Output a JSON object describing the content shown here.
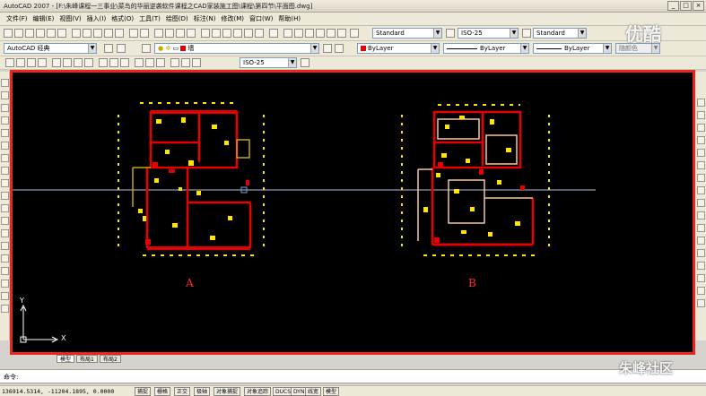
{
  "window": {
    "title": "AutoCAD 2007 - [F:\\朱峰课程一三事业\\菜鸟的华丽逆袭软件课程之CAD家装施工图\\课程\\第四节\\平面图.dwg]",
    "controls": [
      "_",
      "□",
      "×"
    ]
  },
  "menu": [
    "文件(F)",
    "编辑(E)",
    "视图(V)",
    "插入(I)",
    "格式(O)",
    "工具(T)",
    "绘图(D)",
    "标注(N)",
    "修改(M)",
    "窗口(W)",
    "帮助(H)"
  ],
  "toolbar": {
    "text_style": "Standard",
    "dim_style": "ISO-25",
    "table_style": "Standard",
    "workspace": "AutoCAD 经典",
    "layer": "墙",
    "color": "ByLayer",
    "linetype": "ByLayer",
    "lineweight": "ByLayer",
    "plot_style": "随颜色",
    "dim_style_2": "ISO-25"
  },
  "drawing": {
    "label_a": "A",
    "label_b": "B",
    "ucs_y": "Y",
    "ucs_x": "X"
  },
  "tabs": [
    "模型",
    "布局1",
    "布局2"
  ],
  "command": {
    "prompt": "命令:"
  },
  "status": {
    "coordinates": "136914.5314, -11204.1895, 0.0000",
    "buttons": [
      "捕捉",
      "栅格",
      "正交",
      "极轴",
      "对象捕捉",
      "对象追踪",
      "DUCS",
      "DYN",
      "线宽",
      "模型"
    ]
  },
  "watermark": {
    "top": "优酷",
    "bottom": "朱峰社区",
    "bottom_sub": "ZF3D.COM"
  },
  "colors": {
    "canvas": "#000000",
    "frame": "#e8261c",
    "wall": "#e60000",
    "furniture": "#ffe500",
    "crosshair": "#b0c4de"
  }
}
